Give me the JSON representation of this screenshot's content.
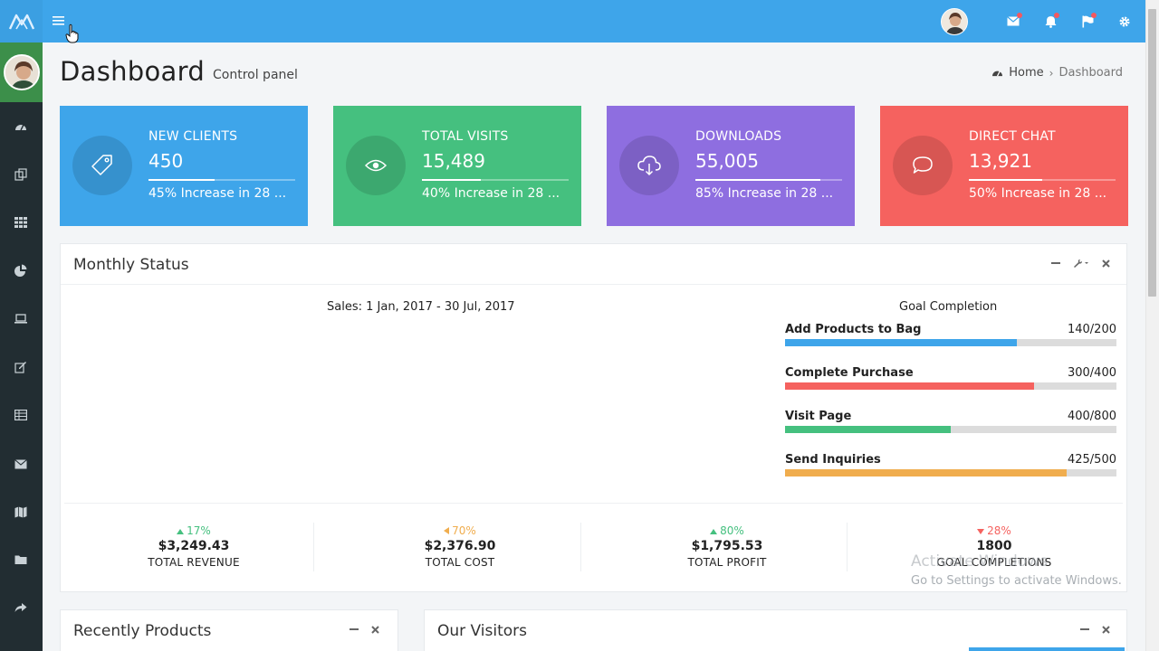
{
  "topbar": {
    "notifications": {
      "mail": true,
      "bell": true,
      "flag": true
    }
  },
  "header": {
    "title": "Dashboard",
    "subtitle": "Control panel",
    "breadcrumb": {
      "home": "Home",
      "current": "Dashboard"
    }
  },
  "cards": [
    {
      "label": "NEW CLIENTS",
      "value": "450",
      "progress": 0.45,
      "desc": "45% Increase in 28 ...",
      "color": "#3ea5ea",
      "icon": "tag-icon"
    },
    {
      "label": "TOTAL VISITS",
      "value": "15,489",
      "progress": 0.4,
      "desc": "40% Increase in 28 ...",
      "color": "#45c07f",
      "icon": "eye-icon"
    },
    {
      "label": "DOWNLOADS",
      "value": "55,005",
      "progress": 0.85,
      "desc": "85% Increase in 28 ...",
      "color": "#8e6ee0",
      "icon": "cloud-download-icon"
    },
    {
      "label": "DIRECT CHAT",
      "value": "13,921",
      "progress": 0.5,
      "desc": "50% Increase in 28 ...",
      "color": "#f5625f",
      "icon": "chat-icon"
    }
  ],
  "monthly": {
    "title": "Monthly Status",
    "sales_title": "Sales: 1 Jan, 2017 - 30 Jul, 2017",
    "goal_title": "Goal Completion",
    "goals": [
      {
        "name": "Add Products to Bag",
        "value": "140/200",
        "progress": 0.7,
        "color": "#3ea5ea"
      },
      {
        "name": "Complete Purchase",
        "value": "300/400",
        "progress": 0.75,
        "color": "#f5625f"
      },
      {
        "name": "Visit Page",
        "value": "400/800",
        "progress": 0.5,
        "color": "#45c07f"
      },
      {
        "name": "Send Inquiries",
        "value": "425/500",
        "progress": 0.85,
        "color": "#f0ad4e"
      }
    ],
    "kpis": [
      {
        "change": "17%",
        "direction": "up",
        "color": "#45c07f",
        "amount": "$3,249.43",
        "label": "TOTAL REVENUE"
      },
      {
        "change": "70%",
        "direction": "left",
        "color": "#f0ad4e",
        "amount": "$2,376.90",
        "label": "TOTAL COST"
      },
      {
        "change": "80%",
        "direction": "up",
        "color": "#45c07f",
        "amount": "$1,795.53",
        "label": "TOTAL PROFIT"
      },
      {
        "change": "28%",
        "direction": "down",
        "color": "#f5625f",
        "amount": "1800",
        "label": "GOAL COMPLETIONS"
      }
    ]
  },
  "watermark": {
    "line1": "Activate Windows",
    "line2": "Go to Settings to activate Windows."
  },
  "recent": {
    "title": "Recently Products"
  },
  "visitors": {
    "title": "Our Visitors"
  }
}
